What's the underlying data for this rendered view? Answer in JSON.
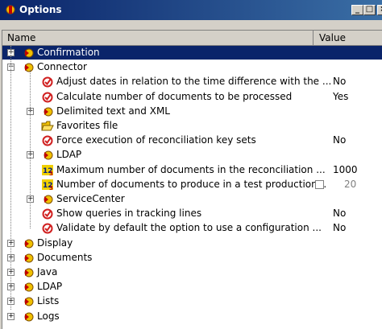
{
  "window": {
    "title": "Options",
    "min_label": "_",
    "max_label": "□",
    "close_label": "×"
  },
  "columns": {
    "name": "Name",
    "value": "Value"
  },
  "colors": {
    "selection": "#0a246a",
    "titlebar": "#0a246a",
    "folder_red": "#c00000",
    "folder_yellow": "#f0c000"
  },
  "rows": [
    {
      "label": "Confirmation",
      "icon": "folder-category-icon",
      "value": "",
      "level": 1,
      "expander": "+",
      "selected": true
    },
    {
      "label": "Connector",
      "icon": "folder-category-icon",
      "value": "",
      "level": 1,
      "expander": "-"
    },
    {
      "label": "Adjust dates in relation to the time difference with the ...",
      "icon": "boolean-option-icon",
      "value": "No",
      "level": 2
    },
    {
      "label": "Calculate number of documents to be processed",
      "icon": "boolean-option-icon",
      "value": "Yes",
      "level": 2
    },
    {
      "label": "Delimited text and XML",
      "icon": "folder-category-icon",
      "value": "",
      "level": 2,
      "expander": "+"
    },
    {
      "label": "Favorites file",
      "icon": "open-folder-icon",
      "value": "",
      "level": 2
    },
    {
      "label": "Force execution of reconciliation key sets",
      "icon": "boolean-option-icon",
      "value": "No",
      "level": 2
    },
    {
      "label": "LDAP",
      "icon": "folder-category-icon",
      "value": "",
      "level": 2,
      "expander": "+"
    },
    {
      "label": "Maximum number of documents in the reconciliation ...",
      "icon": "numeric-option-icon",
      "value": "1000",
      "level": 2
    },
    {
      "label": "Number of documents to produce in a test production...",
      "icon": "numeric-option-icon",
      "value": "20",
      "level": 2,
      "checkbox": true
    },
    {
      "label": "ServiceCenter",
      "icon": "folder-category-icon",
      "value": "",
      "level": 2,
      "expander": "+"
    },
    {
      "label": "Show queries in tracking lines",
      "icon": "boolean-option-icon",
      "value": "No",
      "level": 2
    },
    {
      "label": "Validate by default the option to use a configuration ...",
      "icon": "boolean-option-icon",
      "value": "No",
      "level": 2
    },
    {
      "label": "Display",
      "icon": "folder-category-icon",
      "value": "",
      "level": 1,
      "expander": "+"
    },
    {
      "label": "Documents",
      "icon": "folder-category-icon",
      "value": "",
      "level": 1,
      "expander": "+"
    },
    {
      "label": "Java",
      "icon": "folder-category-icon",
      "value": "",
      "level": 1,
      "expander": "+"
    },
    {
      "label": "LDAP",
      "icon": "folder-category-icon",
      "value": "",
      "level": 1,
      "expander": "+"
    },
    {
      "label": "Lists",
      "icon": "folder-category-icon",
      "value": "",
      "level": 1,
      "expander": "+"
    },
    {
      "label": "Logs",
      "icon": "folder-category-icon",
      "value": "",
      "level": 1,
      "expander": "+"
    }
  ]
}
